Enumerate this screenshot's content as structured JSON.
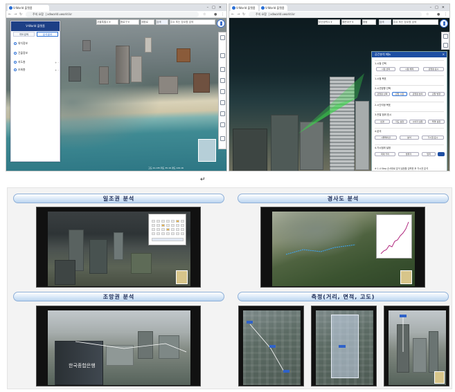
{
  "screens": {
    "left": {
      "tab_title": "V-World 플랫폼",
      "url": "xdworld.vworld.kr",
      "secure_label": "주의 요함",
      "top_tools": [
        "서울특별시 ▾",
        "종로구 ▾",
        "세종로",
        "검색",
        "주소 또는 장소명 검색"
      ],
      "sidepanel": {
        "logo": "V-World 플랫폼",
        "tabs": [
          "지도검색",
          "분석결과"
        ],
        "items": [
          "위치정보",
          "건물정보",
          "지도층",
          "조회층"
        ]
      },
      "status": "고도 21,135   위도 35.16   경도 129.16"
    },
    "right": {
      "tab_title": "V-World 플랫폼",
      "url": "xdworld.vworld.kr",
      "secure_label": "주의 요함",
      "top_tools": [
        "부산광역시 ▾",
        "해운대구 ▾",
        "중동",
        "검색",
        "주소 또는 장소명 검색"
      ],
      "panel": {
        "title": "공간분석 메뉴",
        "rows": [
          {
            "label": "1.시점 선택",
            "chips": [
              "시점 선택",
              "시점 해제",
              "관찰점 표시"
            ]
          },
          {
            "label": "1.시점 목표",
            "chips": []
          },
          {
            "label": "2.시선방향 선택",
            "chips": [
              "관찰점 선택",
              "관찰 시점",
              "관찰점 높이",
              "관찰 방향"
            ]
          },
          {
            "label": "2.시간지정 목표",
            "chips": []
          },
          {
            "label": "3.관찰 범위 표시",
            "chips": [
              "반경",
              "각도 설정",
              "시야각 설정",
              "투명 설정"
            ]
          },
          {
            "label": "4.분석",
            "chips": [
              "시뮬레이션",
              "분석",
              "가시권 표시"
            ]
          },
          {
            "label": "4.가시범위 설정",
            "chips": [
              "최대 거리",
              "방위각",
              "입력"
            ]
          }
        ],
        "footnote": "※ 1-4 Step 순서대로 분석 설정을 입력한 후 가시권 분석"
      }
    }
  },
  "return_mark": "↵",
  "sections": [
    {
      "title": "일조권 분석"
    },
    {
      "title": "경사도 분석"
    },
    {
      "title": "조망권 분석"
    },
    {
      "title": "측정(거리, 면적, 고도)"
    }
  ],
  "building_sign": "한국종합은행",
  "chart": {
    "type": "line"
  },
  "colors": {
    "header_blue": "#1e4fa3",
    "pill_border": "#8fb0d8",
    "chart_line": "#b0267d"
  },
  "icons": [
    "compass-icon",
    "zoom-in-icon",
    "zoom-out-icon",
    "search-icon",
    "star-icon",
    "close-icon"
  ]
}
